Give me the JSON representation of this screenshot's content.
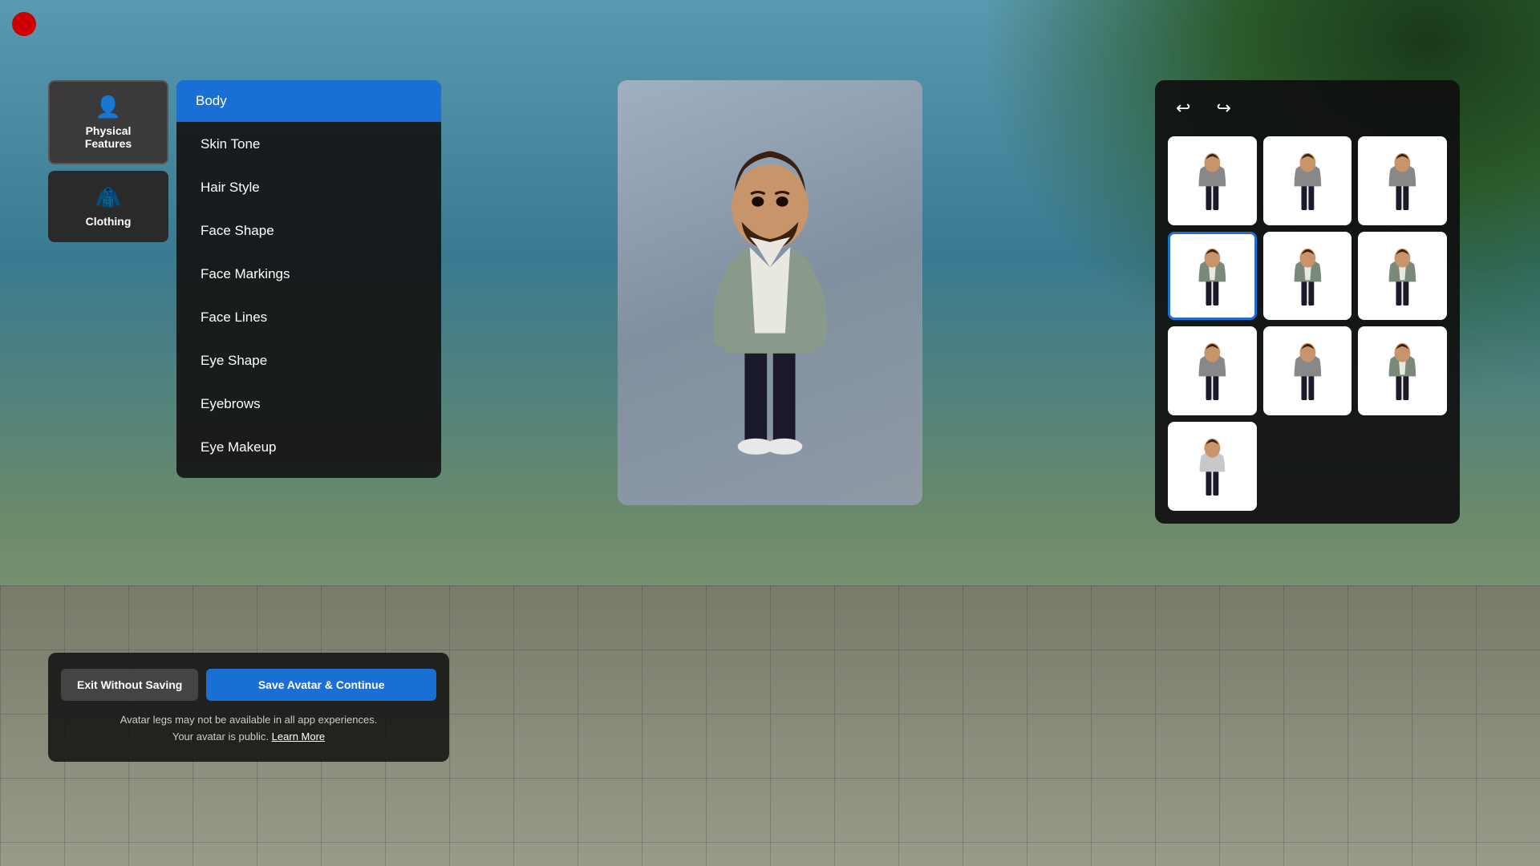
{
  "background": {
    "color_top": "#5a9ab0",
    "color_bottom": "#8a8a7a"
  },
  "red_circle": {
    "visible": true
  },
  "left_panel": {
    "category_tabs": [
      {
        "id": "physical_features",
        "label": "Physical Features",
        "icon": "👤",
        "active": true
      },
      {
        "id": "clothing",
        "label": "Clothing",
        "icon": "👗",
        "active": false
      }
    ],
    "menu_items": [
      {
        "id": "body",
        "label": "Body",
        "selected": true
      },
      {
        "id": "skin_tone",
        "label": "Skin Tone",
        "selected": false
      },
      {
        "id": "hair_style",
        "label": "Hair Style",
        "selected": false
      },
      {
        "id": "face_shape",
        "label": "Face Shape",
        "selected": false
      },
      {
        "id": "face_markings",
        "label": "Face Markings",
        "selected": false
      },
      {
        "id": "face_lines",
        "label": "Face Lines",
        "selected": false
      },
      {
        "id": "eye_shape",
        "label": "Eye Shape",
        "selected": false
      },
      {
        "id": "eyebrows",
        "label": "Eyebrows",
        "selected": false
      },
      {
        "id": "eye_makeup",
        "label": "Eye Makeup",
        "selected": false
      }
    ]
  },
  "bottom_actions": {
    "exit_label": "Exit Without Saving",
    "save_label": "Save Avatar & Continue",
    "notice_line1": "Avatar legs may not be available in all app experiences.",
    "notice_line2": "Your avatar is public.",
    "learn_more": "Learn More"
  },
  "right_panel": {
    "undo_icon": "↩",
    "redo_icon": "↪",
    "outfit_count": 10,
    "selected_index": 3
  },
  "icons": {
    "undo": "↩",
    "redo": "↪",
    "physical_features": "👤",
    "clothing": "🧥"
  }
}
